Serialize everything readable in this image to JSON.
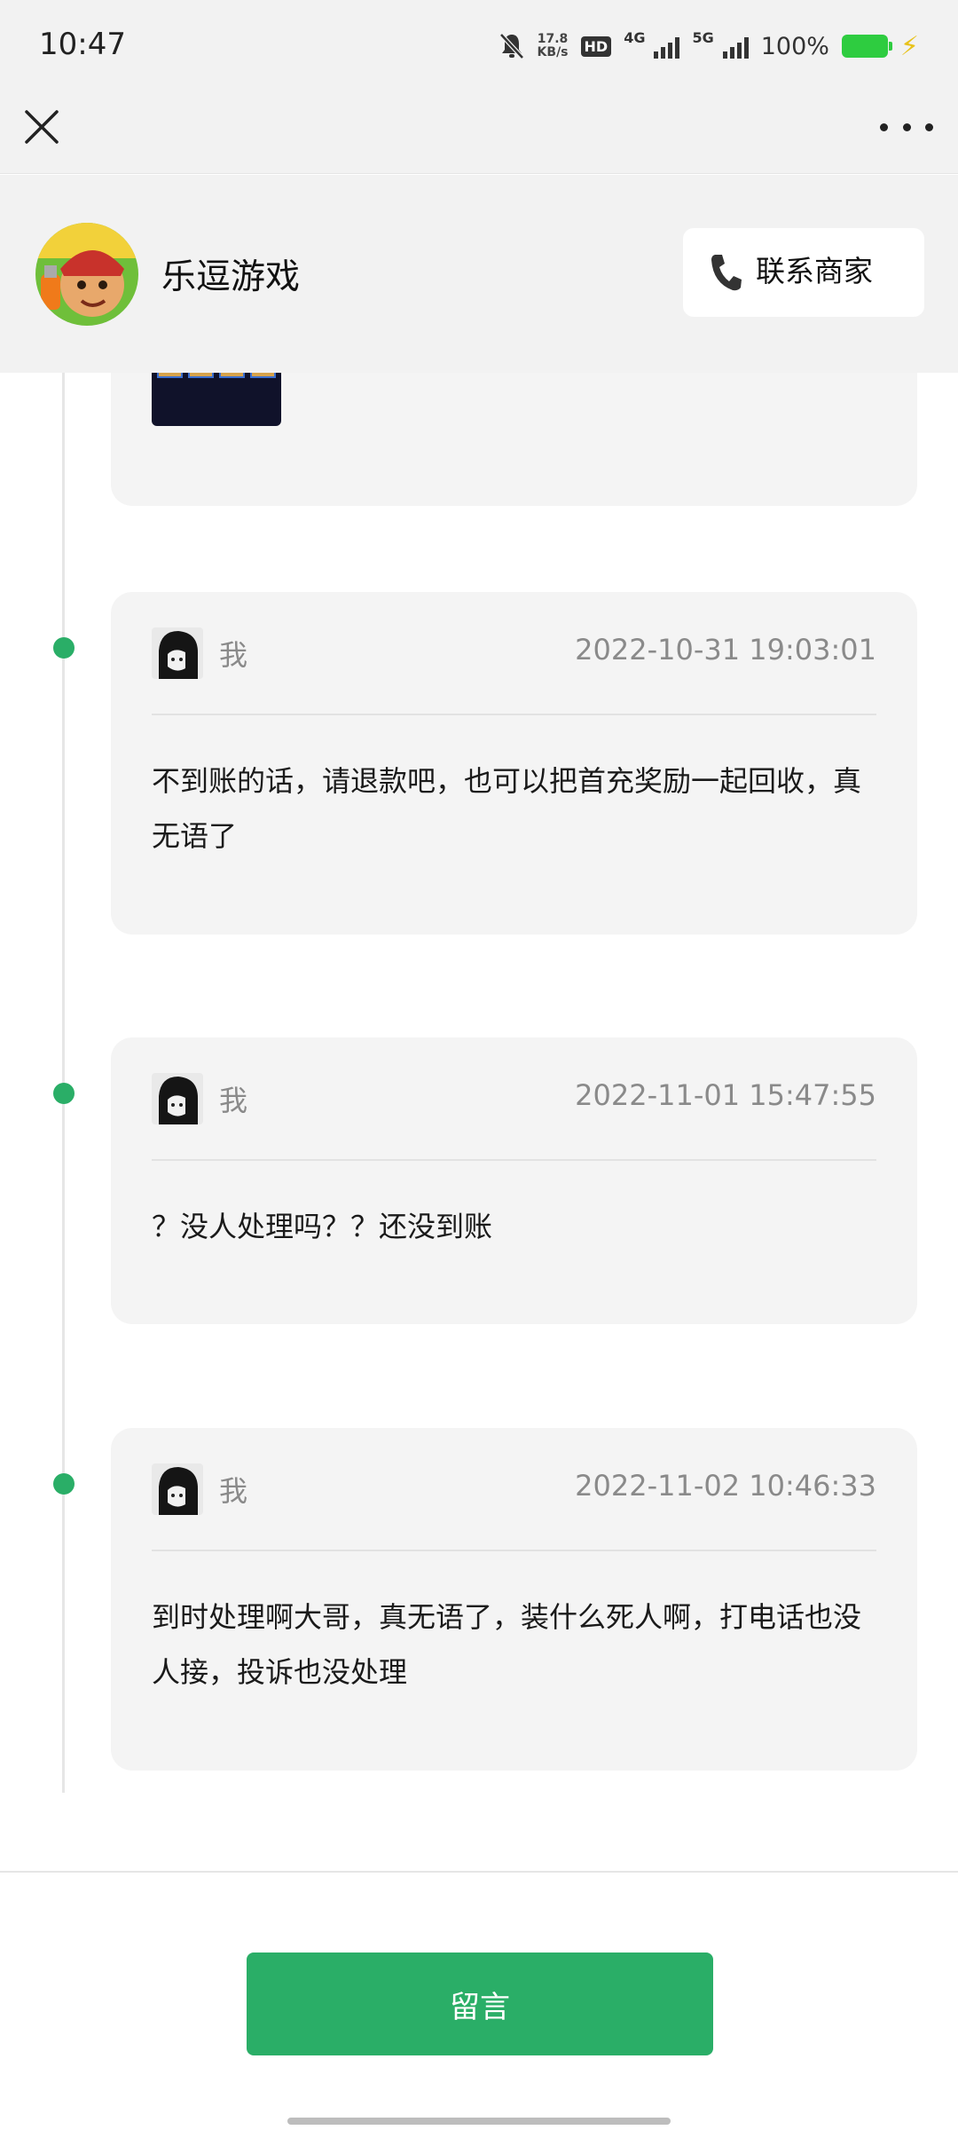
{
  "status_bar": {
    "time": "10:47",
    "net_speed_value": "17.8",
    "net_speed_unit": "KB/s",
    "hd_label": "HD",
    "net_4g": "4G",
    "net_5g": "5G",
    "battery_pct": "100%",
    "icons": [
      "mute-icon",
      "hd-icon",
      "signal-4g-icon",
      "signal-5g-icon",
      "battery-icon",
      "charging-bolt-icon"
    ]
  },
  "nav": {
    "close_icon": "close-icon",
    "more_icon": "more-icon"
  },
  "merchant": {
    "name": "乐逗游戏",
    "contact_label": "联系商家",
    "contact_icon": "phone-icon"
  },
  "messages": [
    {
      "author": "我",
      "timestamp": "2022-10-31 19:03:01",
      "text": "不到账的话，请退款吧，也可以把首充奖励一起回收，真无语了"
    },
    {
      "author": "我",
      "timestamp": "2022-11-01 15:47:55",
      "text": "？没人处理吗？？还没到账"
    },
    {
      "author": "我",
      "timestamp": "2022-11-02 10:46:33",
      "text": "到时处理啊大哥，真无语了，装什么死人啊，打电话也没人接，投诉也没处理"
    }
  ],
  "footer": {
    "leave_message_label": "留言"
  },
  "colors": {
    "accent": "#2aae67",
    "header_bg": "#f2f2f2",
    "card_bg": "#f4f4f4",
    "muted_text": "#8a8a8a"
  }
}
